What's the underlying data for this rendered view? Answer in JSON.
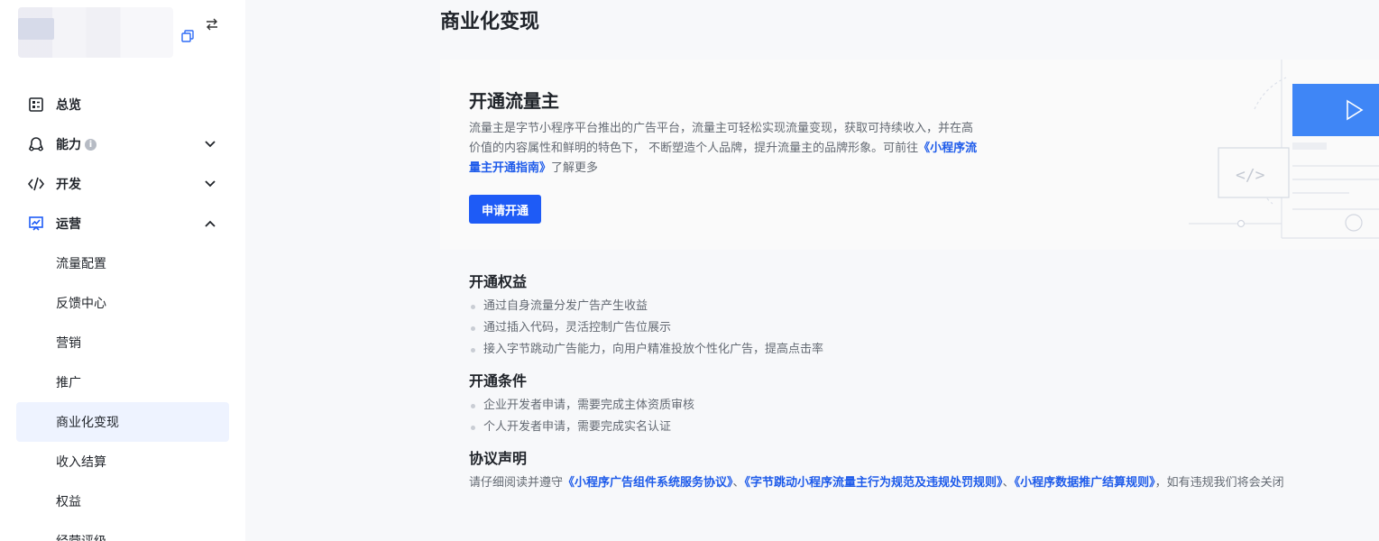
{
  "sidebar": {
    "nav": [
      {
        "label": "总览",
        "icon": "dashboard-icon"
      },
      {
        "label": "能力",
        "icon": "capability-icon"
      },
      {
        "label": "开发",
        "icon": "code-icon"
      },
      {
        "label": "运营",
        "icon": "chart-icon"
      }
    ],
    "operations_sub": [
      "流量配置",
      "反馈中心",
      "营销",
      "推广",
      "商业化变现",
      "收入结算",
      "权益",
      "经营评级"
    ],
    "active_sub": "商业化变现"
  },
  "page": {
    "title": "商业化变现"
  },
  "banner": {
    "title": "开通流量主",
    "desc_part1": "流量主是字节小程序平台推出的广告平台，流量主可轻松实现流量变现，获取可持续收入，并在高价值的内容属性和鲜明的特色下， 不断塑造个人品牌，提升流量主的品牌形象。可前往",
    "desc_link": "《小程序流量主开通指南》",
    "desc_part2": "了解更多",
    "apply_label": "申请开通"
  },
  "benefits": {
    "title": "开通权益",
    "items": [
      "通过自身流量分发广告产生收益",
      "通过插入代码，灵活控制广告位展示",
      "接入字节跳动广告能力，向用户精准投放个性化广告，提高点击率"
    ]
  },
  "conditions": {
    "title": "开通条件",
    "items": [
      "企业开发者申请，需要完成主体资质审核",
      "个人开发者申请，需要完成实名认证"
    ]
  },
  "agreement": {
    "title": "协议声明",
    "prefix": "请仔细阅读并遵守",
    "link1": "《小程序广告组件系统服务协议》",
    "sep1": "、",
    "link2": "《字节跳动小程序流量主行为规范及违规处罚规则》",
    "sep2": "、",
    "link3": "《小程序数据推广结算规则》",
    "suffix": "，如有违规我们将会关闭"
  },
  "colors": {
    "accent": "#1e5bf6",
    "link": "#1e5bea",
    "active_bg": "#eef3ff"
  }
}
